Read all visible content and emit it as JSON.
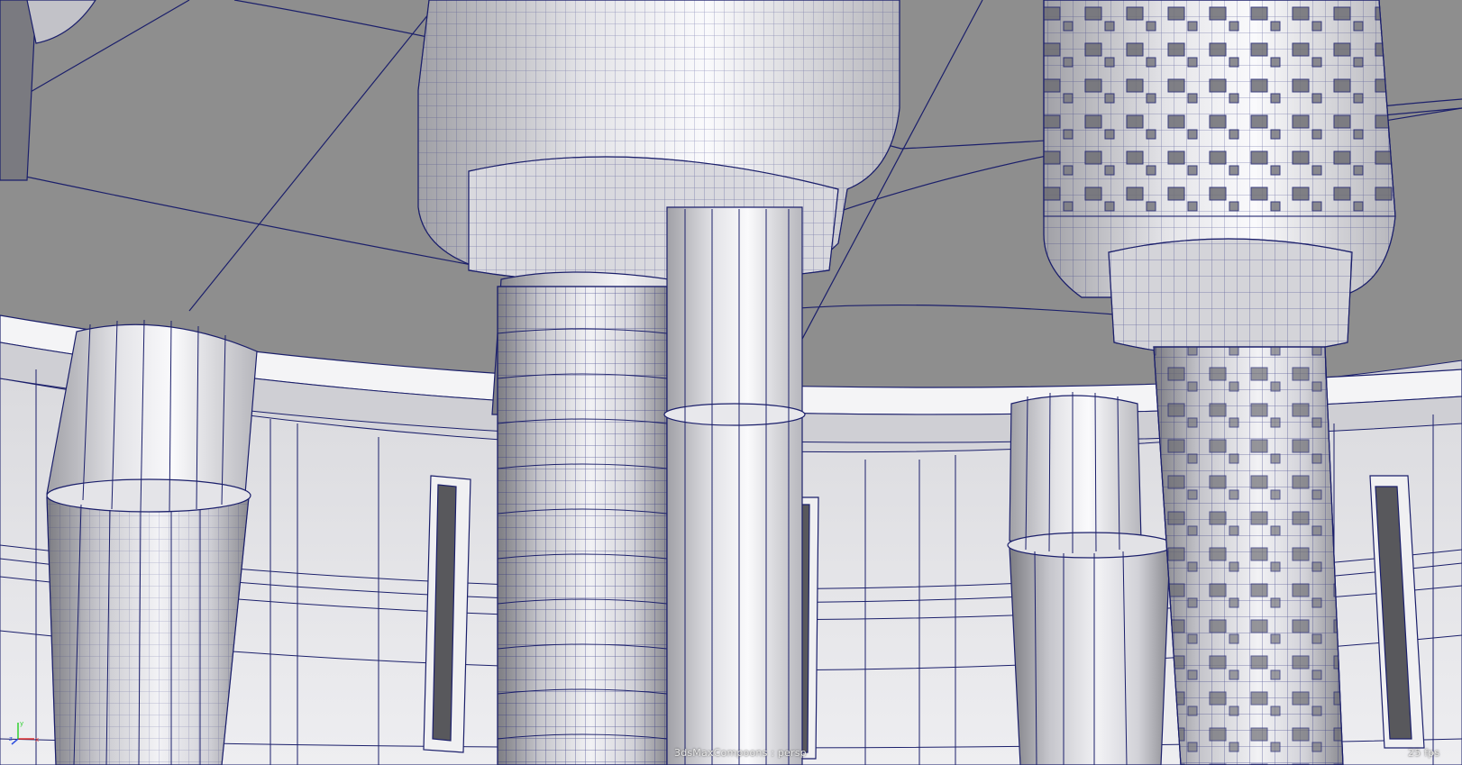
{
  "viewport": {
    "camera_label": "3dsMaxCompoons : persp",
    "fps_readout": "25 fps"
  },
  "axis_gizmo": {
    "x_label": "x",
    "y_label": "y",
    "z_label": "z",
    "x_color": "#e03030",
    "y_color": "#30d030",
    "z_color": "#3050e0"
  },
  "colors": {
    "background": "#8e8e8e",
    "wireframe": "#1b1f6b",
    "mesh_light": "#e6e6ea",
    "mesh_mid": "#c4c4ca",
    "mesh_dark": "#5a5a5e"
  }
}
